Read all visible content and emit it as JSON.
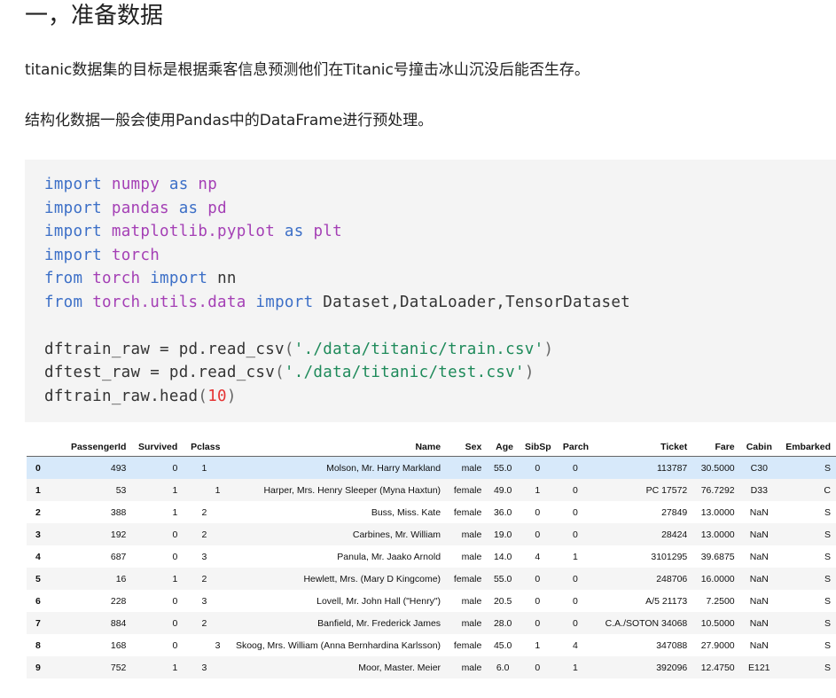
{
  "heading": "一，准备数据",
  "paragraphs": [
    "titanic数据集的目标是根据乘客信息预测他们在Titanic号撞击冰山沉没后能否生存。",
    "结构化数据一般会使用Pandas中的DataFrame进行预处理。"
  ],
  "code": {
    "lines": [
      [
        {
          "t": "import",
          "c": "kw"
        },
        {
          "t": " "
        },
        {
          "t": "numpy",
          "c": "mod"
        },
        {
          "t": " "
        },
        {
          "t": "as",
          "c": "kw"
        },
        {
          "t": " "
        },
        {
          "t": "np",
          "c": "mod"
        }
      ],
      [
        {
          "t": "import",
          "c": "kw"
        },
        {
          "t": " "
        },
        {
          "t": "pandas",
          "c": "mod"
        },
        {
          "t": " "
        },
        {
          "t": "as",
          "c": "kw"
        },
        {
          "t": " "
        },
        {
          "t": "pd",
          "c": "mod"
        }
      ],
      [
        {
          "t": "import",
          "c": "kw"
        },
        {
          "t": " "
        },
        {
          "t": "matplotlib.pyplot",
          "c": "mod"
        },
        {
          "t": " "
        },
        {
          "t": "as",
          "c": "kw"
        },
        {
          "t": " "
        },
        {
          "t": "plt",
          "c": "mod"
        }
      ],
      [
        {
          "t": "import",
          "c": "kw"
        },
        {
          "t": " "
        },
        {
          "t": "torch",
          "c": "mod"
        }
      ],
      [
        {
          "t": "from",
          "c": "kw"
        },
        {
          "t": " "
        },
        {
          "t": "torch",
          "c": "mod"
        },
        {
          "t": " "
        },
        {
          "t": "import",
          "c": "kw"
        },
        {
          "t": " nn"
        }
      ],
      [
        {
          "t": "from",
          "c": "kw"
        },
        {
          "t": " "
        },
        {
          "t": "torch.utils.data",
          "c": "mod"
        },
        {
          "t": " "
        },
        {
          "t": "import",
          "c": "kw"
        },
        {
          "t": " Dataset,DataLoader,TensorDataset"
        }
      ],
      [
        {
          "t": ""
        }
      ],
      [
        {
          "t": "dftrain_raw = pd.read_csv"
        },
        {
          "t": "(",
          "c": "punc"
        },
        {
          "t": "'./data/titanic/train.csv'",
          "c": "str"
        },
        {
          "t": ")",
          "c": "punc"
        }
      ],
      [
        {
          "t": "dftest_raw = pd.read_csv"
        },
        {
          "t": "(",
          "c": "punc"
        },
        {
          "t": "'./data/titanic/test.csv'",
          "c": "str"
        },
        {
          "t": ")",
          "c": "punc"
        }
      ],
      [
        {
          "t": "dftrain_raw.head"
        },
        {
          "t": "(",
          "c": "punc"
        },
        {
          "t": "10",
          "c": "num"
        },
        {
          "t": ")",
          "c": "punc"
        }
      ]
    ]
  },
  "table": {
    "columns": [
      "",
      "PassengerId",
      "Survived",
      "Pclass",
      "Name",
      "Sex",
      "Age",
      "SibSp",
      "Parch",
      "Ticket",
      "Fare",
      "Cabin",
      "Embarked"
    ],
    "highlighted_row": 0,
    "rows": [
      [
        "0",
        "493",
        "0",
        "1",
        "Molson, Mr. Harry Markland",
        "male",
        "55.0",
        "0",
        "0",
        "113787",
        "30.5000",
        "C30",
        "S"
      ],
      [
        "1",
        "53",
        "1",
        "1",
        "Harper, Mrs. Henry Sleeper (Myna Haxtun)",
        "female",
        "49.0",
        "1",
        "0",
        "PC 17572",
        "76.7292",
        "D33",
        "C"
      ],
      [
        "2",
        "388",
        "1",
        "2",
        "Buss, Miss. Kate",
        "female",
        "36.0",
        "0",
        "0",
        "27849",
        "13.0000",
        "NaN",
        "S"
      ],
      [
        "3",
        "192",
        "0",
        "2",
        "Carbines, Mr. William",
        "male",
        "19.0",
        "0",
        "0",
        "28424",
        "13.0000",
        "NaN",
        "S"
      ],
      [
        "4",
        "687",
        "0",
        "3",
        "Panula, Mr. Jaako Arnold",
        "male",
        "14.0",
        "4",
        "1",
        "3101295",
        "39.6875",
        "NaN",
        "S"
      ],
      [
        "5",
        "16",
        "1",
        "2",
        "Hewlett, Mrs. (Mary D Kingcome)",
        "female",
        "55.0",
        "0",
        "0",
        "248706",
        "16.0000",
        "NaN",
        "S"
      ],
      [
        "6",
        "228",
        "0",
        "3",
        "Lovell, Mr. John Hall (\"Henry\")",
        "male",
        "20.5",
        "0",
        "0",
        "A/5 21173",
        "7.2500",
        "NaN",
        "S"
      ],
      [
        "7",
        "884",
        "0",
        "2",
        "Banfield, Mr. Frederick James",
        "male",
        "28.0",
        "0",
        "0",
        "C.A./SOTON 34068",
        "10.5000",
        "NaN",
        "S"
      ],
      [
        "8",
        "168",
        "0",
        "3",
        "Skoog, Mrs. William (Anna Bernhardina Karlsson)",
        "female",
        "45.0",
        "1",
        "4",
        "347088",
        "27.9000",
        "NaN",
        "S"
      ],
      [
        "9",
        "752",
        "1",
        "3",
        "Moor, Master. Meier",
        "male",
        "6.0",
        "0",
        "1",
        "392096",
        "12.4750",
        "E121",
        "S"
      ]
    ]
  }
}
